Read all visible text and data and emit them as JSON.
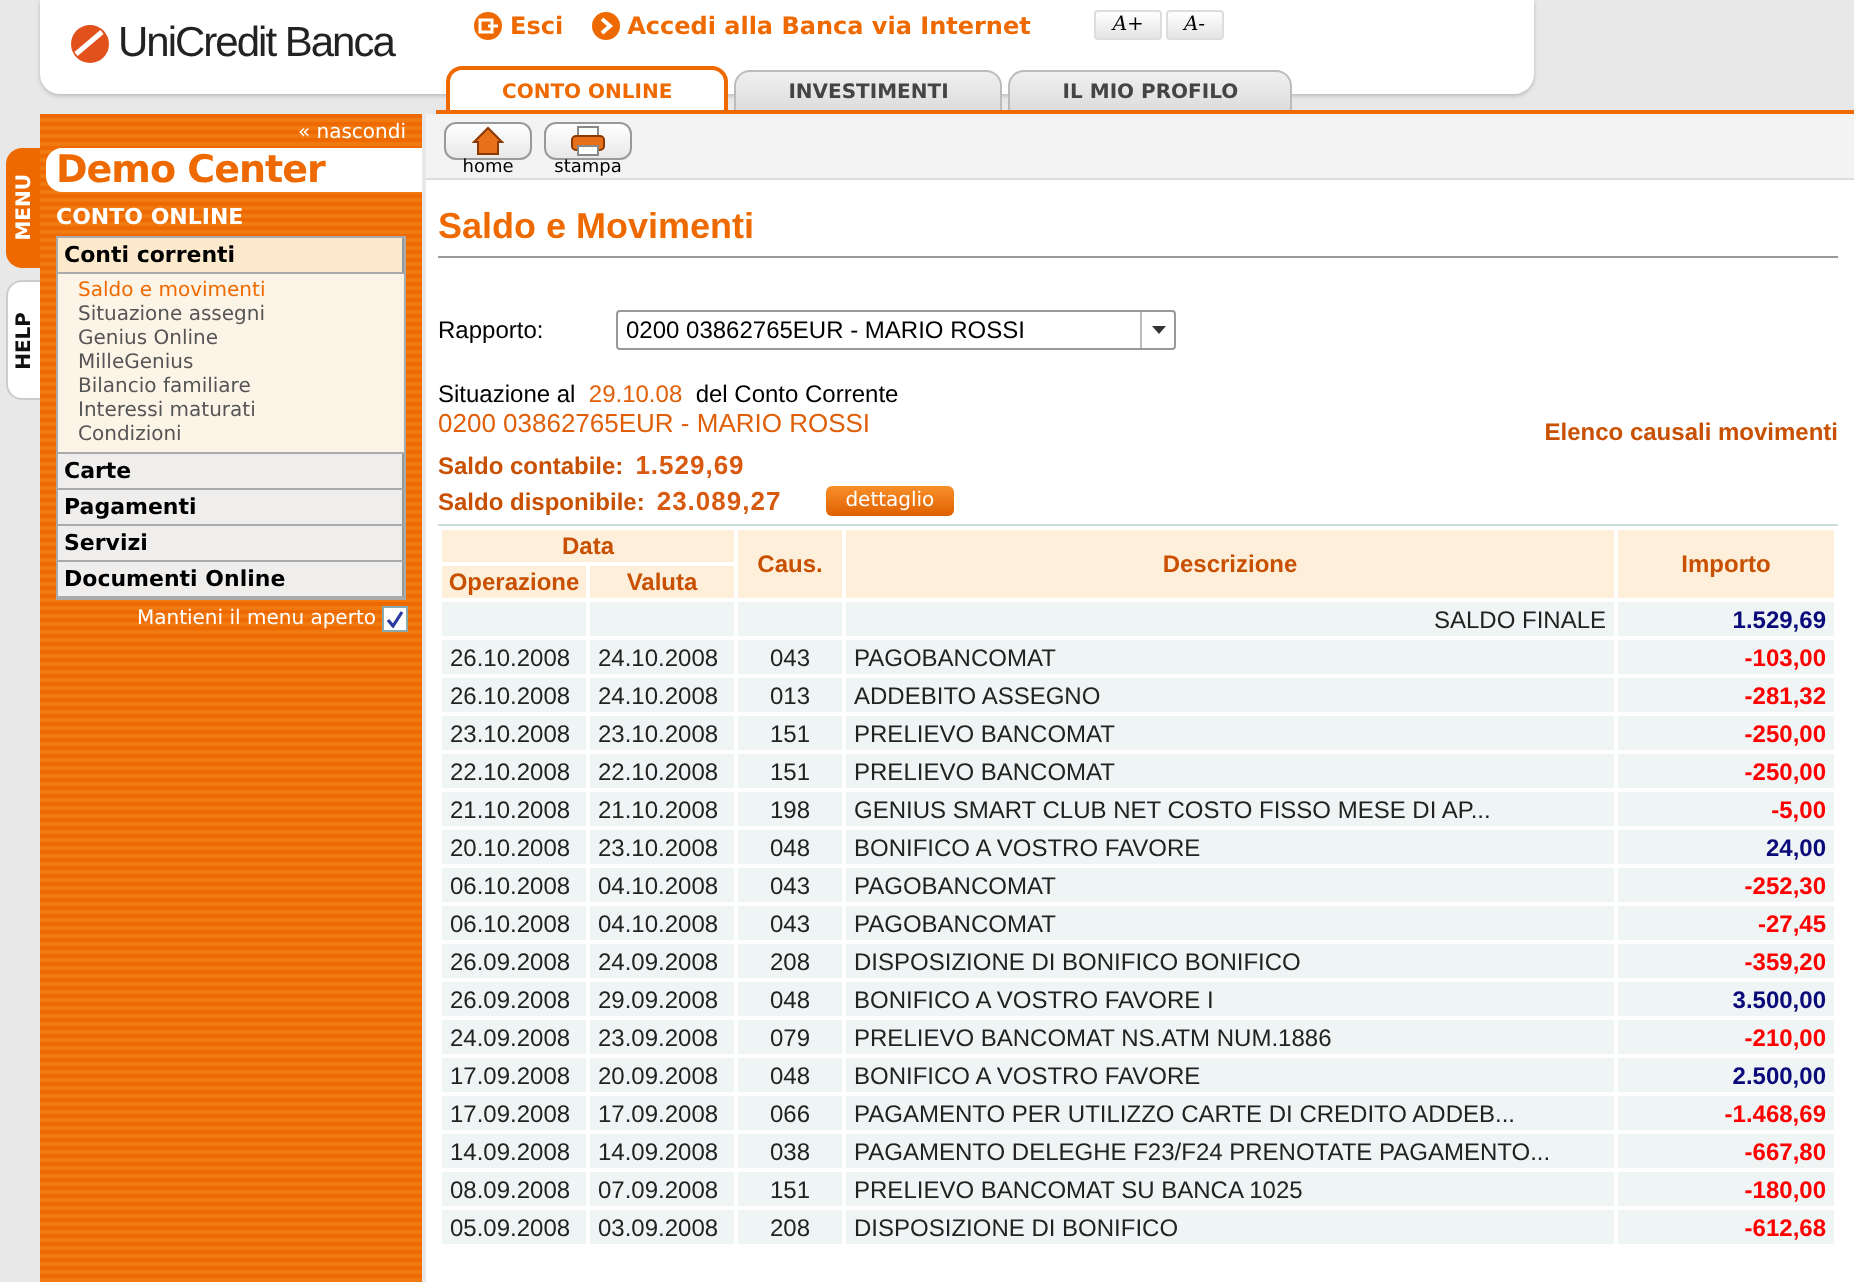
{
  "header": {
    "logo": "UniCredit Banca",
    "links": [
      "Esci",
      "Accedi alla Banca via Internet"
    ],
    "font_buttons": [
      "A+",
      "A-"
    ]
  },
  "tabs": [
    {
      "label": "CONTO ONLINE",
      "selected": true
    },
    {
      "label": "INVESTIMENTI",
      "selected": false
    },
    {
      "label": "IL MIO PROFILO",
      "selected": false
    }
  ],
  "side_tabs": [
    {
      "label": "MENU",
      "selected": true
    },
    {
      "label": "HELP",
      "selected": false
    }
  ],
  "sidebar": {
    "hide_link": "« nascondi",
    "title": "Demo Center",
    "section": "CONTO ONLINE",
    "groups": [
      {
        "label": "Conti correnti",
        "expanded": true,
        "items": [
          {
            "label": "Saldo e movimenti",
            "selected": true
          },
          {
            "label": "Situazione assegni",
            "selected": false
          },
          {
            "label": "Genius Online",
            "selected": false
          },
          {
            "label": "MilleGenius",
            "selected": false
          },
          {
            "label": "Bilancio familiare",
            "selected": false
          },
          {
            "label": "Interessi maturati",
            "selected": false
          },
          {
            "label": "Condizioni",
            "selected": false
          }
        ]
      },
      {
        "label": "Carte",
        "expanded": false
      },
      {
        "label": "Pagamenti",
        "expanded": false
      },
      {
        "label": "Servizi",
        "expanded": false
      },
      {
        "label": "Documenti Online",
        "expanded": false
      }
    ],
    "keep_open": {
      "label": "Mantieni il menu aperto",
      "checked": true
    }
  },
  "toolbar": [
    {
      "label": "home",
      "kind": "home"
    },
    {
      "label": "stampa",
      "kind": "print"
    }
  ],
  "page_title": "Saldo e Movimenti",
  "rapporto": {
    "label": "Rapporto:",
    "value": "0200 03862765EUR - MARIO ROSSI"
  },
  "situazione": {
    "prefix": "Situazione al",
    "date": "29.10.08",
    "suffix": "del Conto Corrente",
    "account": "0200 03862765EUR - MARIO ROSSI"
  },
  "causali_link": "Elenco causali movimenti",
  "balances": [
    {
      "label": "Saldo contabile:",
      "value": "1.529,69"
    },
    {
      "label": "Saldo disponibile:",
      "value": "23.089,27",
      "button": "dettaglio"
    }
  ],
  "table": {
    "group_header": "Data",
    "columns": [
      "Operazione",
      "Valuta",
      "Caus.",
      "Descrizione",
      "Importo"
    ],
    "final": {
      "label": "SALDO FINALE",
      "amount": "1.529,69"
    },
    "rows": [
      {
        "operazione": "26.10.2008",
        "valuta": "24.10.2008",
        "caus": "043",
        "descrizione": "PAGOBANCOMAT",
        "importo": "-103,00",
        "kind": "debit"
      },
      {
        "operazione": "26.10.2008",
        "valuta": "24.10.2008",
        "caus": "013",
        "descrizione": "ADDEBITO ASSEGNO",
        "importo": "-281,32",
        "kind": "debit"
      },
      {
        "operazione": "23.10.2008",
        "valuta": "23.10.2008",
        "caus": "151",
        "descrizione": "PRELIEVO BANCOMAT",
        "importo": "-250,00",
        "kind": "debit"
      },
      {
        "operazione": "22.10.2008",
        "valuta": "22.10.2008",
        "caus": "151",
        "descrizione": "PRELIEVO BANCOMAT",
        "importo": "-250,00",
        "kind": "debit"
      },
      {
        "operazione": "21.10.2008",
        "valuta": "21.10.2008",
        "caus": "198",
        "descrizione": "GENIUS SMART CLUB NET COSTO FISSO MESE DI AP...",
        "importo": "-5,00",
        "kind": "debit"
      },
      {
        "operazione": "20.10.2008",
        "valuta": "23.10.2008",
        "caus": "048",
        "descrizione": "BONIFICO A VOSTRO FAVORE",
        "importo": "24,00",
        "kind": "credit"
      },
      {
        "operazione": "06.10.2008",
        "valuta": "04.10.2008",
        "caus": "043",
        "descrizione": "PAGOBANCOMAT",
        "importo": "-252,30",
        "kind": "debit"
      },
      {
        "operazione": "06.10.2008",
        "valuta": "04.10.2008",
        "caus": "043",
        "descrizione": "PAGOBANCOMAT",
        "importo": "-27,45",
        "kind": "debit"
      },
      {
        "operazione": "26.09.2008",
        "valuta": "24.09.2008",
        "caus": "208",
        "descrizione": "DISPOSIZIONE DI BONIFICO BONIFICO",
        "importo": "-359,20",
        "kind": "debit"
      },
      {
        "operazione": "26.09.2008",
        "valuta": "29.09.2008",
        "caus": "048",
        "descrizione": "BONIFICO A VOSTRO FAVORE I",
        "importo": "3.500,00",
        "kind": "credit"
      },
      {
        "operazione": "24.09.2008",
        "valuta": "23.09.2008",
        "caus": "079",
        "descrizione": "PRELIEVO BANCOMAT NS.ATM NUM.1886",
        "importo": "-210,00",
        "kind": "debit"
      },
      {
        "operazione": "17.09.2008",
        "valuta": "20.09.2008",
        "caus": "048",
        "descrizione": "BONIFICO A VOSTRO FAVORE",
        "importo": "2.500,00",
        "kind": "credit"
      },
      {
        "operazione": "17.09.2008",
        "valuta": "17.09.2008",
        "caus": "066",
        "descrizione": "PAGAMENTO PER UTILIZZO CARTE DI CREDITO ADDEB...",
        "importo": "-1.468,69",
        "kind": "debit"
      },
      {
        "operazione": "14.09.2008",
        "valuta": "14.09.2008",
        "caus": "038",
        "descrizione": "PAGAMENTO DELEGHE F23/F24 PRENOTATE PAGAMENTO...",
        "importo": "-667,80",
        "kind": "debit"
      },
      {
        "operazione": "08.09.2008",
        "valuta": "07.09.2008",
        "caus": "151",
        "descrizione": "PRELIEVO BANCOMAT SU BANCA 1025",
        "importo": "-180,00",
        "kind": "debit"
      },
      {
        "operazione": "05.09.2008",
        "valuta": "03.09.2008",
        "caus": "208",
        "descrizione": "DISPOSIZIONE DI BONIFICO",
        "importo": "-612,68",
        "kind": "debit"
      }
    ]
  }
}
